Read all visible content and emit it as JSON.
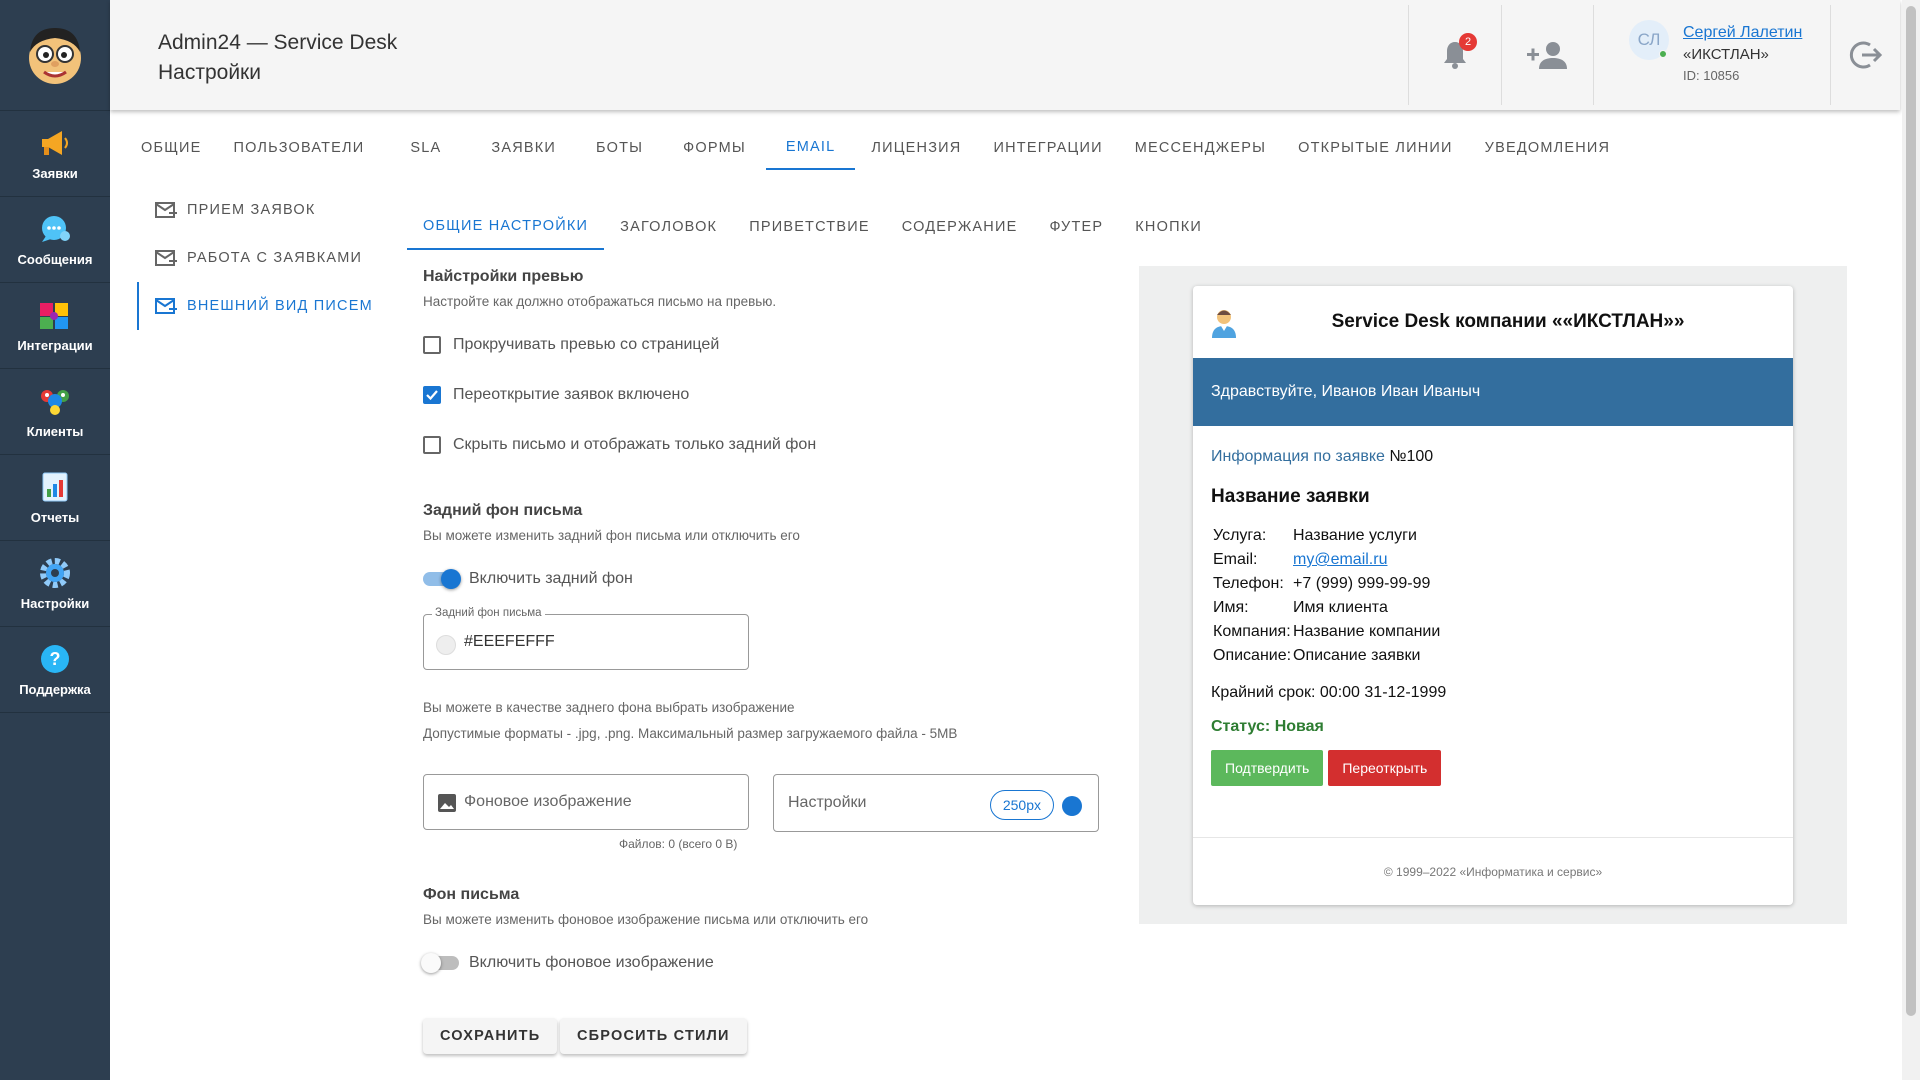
{
  "sidebar": {
    "logo": "face-logo",
    "items": [
      {
        "label": "Заявки",
        "icon": "megaphone-icon"
      },
      {
        "label": "Сообщения",
        "icon": "chat-bubble-icon"
      },
      {
        "label": "Интеграции",
        "icon": "puzzle-icon"
      },
      {
        "label": "Клиенты",
        "icon": "people-icon"
      },
      {
        "label": "Отчеты",
        "icon": "report-icon"
      },
      {
        "label": "Настройки",
        "icon": "gear-icon"
      },
      {
        "label": "Поддержка",
        "icon": "help-icon"
      }
    ]
  },
  "header": {
    "app_title": "Admin24 — Service Desk",
    "page_title": "Настройки",
    "notifications_count": "2",
    "user": {
      "initials": "СЛ",
      "name": "Сергей Лалетин",
      "company": "«ИКСТЛАН»",
      "id": "ID: 10856"
    }
  },
  "tabs": [
    {
      "label": "ОБЩИЕ"
    },
    {
      "label": "ПОЛЬЗОВАТЕЛИ"
    },
    {
      "label": "SLA"
    },
    {
      "label": "ЗАЯВКИ"
    },
    {
      "label": "БОТЫ"
    },
    {
      "label": "ФОРМЫ"
    },
    {
      "label": "EMAIL",
      "active": true
    },
    {
      "label": "ЛИЦЕНЗИЯ"
    },
    {
      "label": "ИНТЕГРАЦИИ"
    },
    {
      "label": "МЕССЕНДЖЕРЫ"
    },
    {
      "label": "ОТКРЫТЫЕ ЛИНИИ"
    },
    {
      "label": "УВЕДОМЛЕНИЯ"
    }
  ],
  "subnav": [
    {
      "label": "ПРИЕМ ЗАЯВОК"
    },
    {
      "label": "РАБОТА С ЗАЯВКАМИ"
    },
    {
      "label": "ВНЕШНИЙ ВИД ПИСЕМ",
      "active": true
    }
  ],
  "inner_tabs": [
    {
      "label": "ОБЩИЕ НАСТРОЙКИ",
      "active": true
    },
    {
      "label": "ЗАГОЛОВОК"
    },
    {
      "label": "ПРИВЕТСТВИЕ"
    },
    {
      "label": "СОДЕРЖАНИЕ"
    },
    {
      "label": "ФУТЕР"
    },
    {
      "label": "КНОПКИ"
    }
  ],
  "preview_settings": {
    "title": "Найстройки превью",
    "desc": "Настройте как должно отображаться письмо на превью.",
    "options": [
      {
        "label": "Прокручивать превью со страницей",
        "checked": false
      },
      {
        "label": "Переоткрытие заявок включено",
        "checked": true
      },
      {
        "label": "Скрыть письмо и отображать только задний фон",
        "checked": false
      }
    ]
  },
  "background": {
    "title": "Задний фон письма",
    "desc": "Вы можете изменить задний фон письма или отключить его",
    "toggle_label": "Включить задний фон",
    "toggle_on": true,
    "field_label": "Задний фон письма",
    "field_value": "#EEEFEFFF",
    "hint1": "Вы можете в качестве заднего фона выбрать изображение",
    "hint2": "Допустимые форматы - .jpg, .png. Максимальный размер загружаемого файла - 5MB",
    "image_placeholder": "Фоновое изображение",
    "settings_label": "Настройки",
    "size_chip": "250px",
    "files_info": "Файлов: 0 (всего 0 B)"
  },
  "letter_bg": {
    "title": "Фон письма",
    "desc": "Вы можете изменить фоновое изображение письма или отключить его",
    "toggle_label": "Включить фоновое изображение",
    "toggle_on": false
  },
  "buttons": {
    "save": "СОХРАНИТЬ",
    "reset": "СБРОСИТЬ СТИЛИ"
  },
  "preview": {
    "background_color": "#eeefef",
    "title": "Service Desk компании ««ИКСТЛАН»»",
    "greeting": "Здравствуйте, Иванов Иван Иваныч",
    "greeting_color": "#336e9e",
    "info_label": "Информация по заявке",
    "info_number": "№100",
    "request_title": "Название заявки",
    "details": [
      {
        "key": "Услуга:",
        "value": "Название услуги"
      },
      {
        "key": "Email:",
        "value": "my@email.ru"
      },
      {
        "key": "Телефон:",
        "value": "+7 (999) 999-99-99"
      },
      {
        "key": "Имя:",
        "value": "Имя клиента"
      },
      {
        "key": "Компания:",
        "value": "Название компании"
      },
      {
        "key": "Описание:",
        "value": "Описание заявки"
      }
    ],
    "deadline_label": "Крайний срок:",
    "deadline_value": "00:00 31-12-1999",
    "status": "Статус: Новая",
    "confirm_label": "Подтвердить",
    "confirm_color": "#5cb85c",
    "reopen_label": "Переоткрыть",
    "reopen_color": "#d32f2f",
    "footer": "© 1999–2022 «Информатика и сервис»"
  },
  "accent_color": "#1976d2",
  "sidebar_color": "#2d3e50"
}
